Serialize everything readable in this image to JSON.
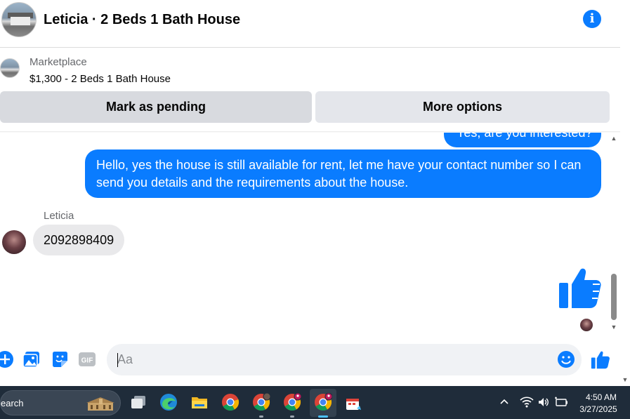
{
  "header": {
    "title": "Leticia · 2 Beds 1 Bath House",
    "info_icon": "i"
  },
  "listing": {
    "source": "Marketplace",
    "title": "$1,300 - 2 Beds 1 Bath House"
  },
  "actions": {
    "pending_label": "Mark as pending",
    "more_label": "More options"
  },
  "messages": {
    "partial_outgoing": "Yes, are you interested?",
    "outgoing_long": "Hello, yes the house is still available for rent, let me have your contact number so I can send you details and the requirements about the house.",
    "sender_name": "Leticia",
    "incoming": "2092898409"
  },
  "composer": {
    "placeholder": "Aa"
  },
  "taskbar": {
    "search_label": "earch",
    "time": "4:50 AM",
    "date": "3/27/2025"
  },
  "colors": {
    "accent": "#0a7cff",
    "incoming_bubble": "#e9e9eb",
    "taskbar": "#1f2c3a"
  }
}
